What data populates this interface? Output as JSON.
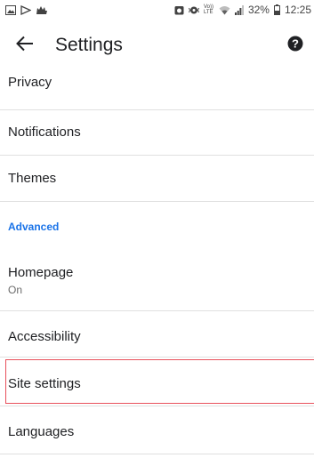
{
  "status_bar": {
    "left_icons": [
      "image-icon",
      "play-icon",
      "cat-icon"
    ],
    "right_icons": [
      "alarm-icon",
      "vibrate-icon",
      "volte-icon",
      "wifi-icon",
      "signal-icon"
    ],
    "volte_text": "Vo)) LTE",
    "battery": "32%",
    "time": "12:25"
  },
  "toolbar": {
    "title": "Settings",
    "back_icon": "arrow-back-icon",
    "help_icon": "help-icon"
  },
  "settings": {
    "privacy": "Privacy",
    "notifications": "Notifications",
    "themes": "Themes",
    "advanced_header": "Advanced",
    "homepage": "Homepage",
    "homepage_summary": "On",
    "accessibility": "Accessibility",
    "site_settings": "Site settings",
    "languages": "Languages"
  },
  "colors": {
    "accent": "#1a73e8",
    "highlight_border": "#e8505b",
    "divider": "#e0e0e0"
  }
}
